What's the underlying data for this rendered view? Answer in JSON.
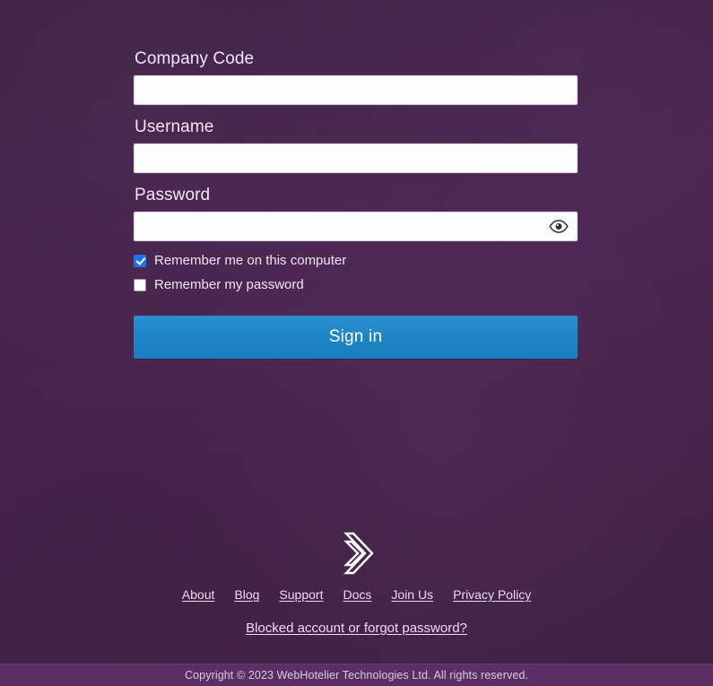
{
  "theme": {
    "background_color": "#452248",
    "accent_button_color": "#1f86c6",
    "checkbox_checked_color": "#1a73e8",
    "label_text_color": "#f3e7f7",
    "footer_bar_color": "#5b2f66"
  },
  "form": {
    "company_code": {
      "label": "Company Code",
      "value": "",
      "placeholder": ""
    },
    "username": {
      "label": "Username",
      "value": "",
      "placeholder": ""
    },
    "password": {
      "label": "Password",
      "value": "",
      "placeholder": "",
      "reveal_icon": "eye-icon"
    },
    "checkboxes": [
      {
        "label": "Remember me on this computer",
        "checked": true
      },
      {
        "label": "Remember my password",
        "checked": false
      }
    ],
    "submit": {
      "label": "Sign in"
    }
  },
  "footer": {
    "logo_icon": "double-chevron-logo",
    "links": [
      {
        "label": "About"
      },
      {
        "label": "Blog"
      },
      {
        "label": "Support"
      },
      {
        "label": "Docs"
      },
      {
        "label": "Join Us"
      },
      {
        "label": "Privacy Policy"
      }
    ],
    "blocked_account_link": "Blocked account or forgot password?",
    "copyright": "Copyright © 2023 WebHotelier Technologies Ltd. All rights reserved."
  }
}
